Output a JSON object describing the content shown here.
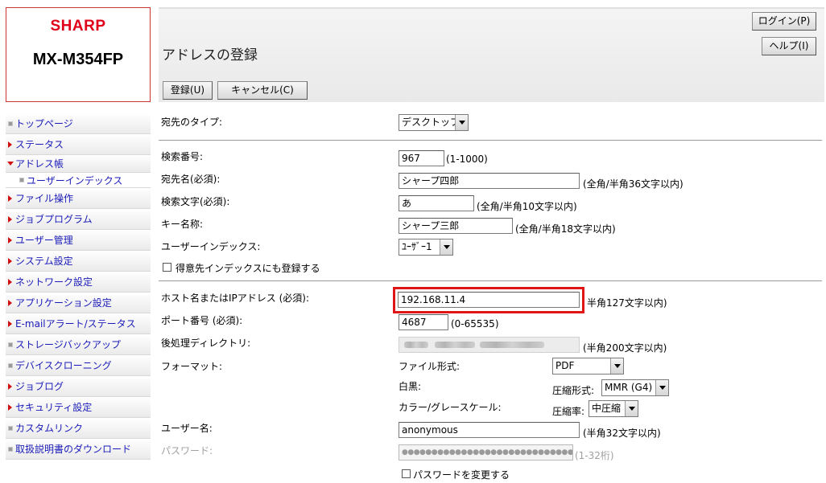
{
  "brand": "SHARP",
  "model": "MX-M354FP",
  "header": {
    "title": "アドレスの登録",
    "login_label": "ログイン(P)",
    "help_label": "ヘルプ(I)",
    "register_label": "登録(U)",
    "cancel_label": "キャンセル(C)"
  },
  "sidebar": {
    "items": [
      {
        "label": "トップページ",
        "marker": "square"
      },
      {
        "label": "ステータス",
        "marker": "arrow-right"
      },
      {
        "label": "アドレス帳",
        "marker": "arrow-down"
      },
      {
        "label": "ユーザーインデックス",
        "marker": "square"
      },
      {
        "label": "ファイル操作",
        "marker": "arrow-right"
      },
      {
        "label": "ジョブプログラム",
        "marker": "arrow-right"
      },
      {
        "label": "ユーザー管理",
        "marker": "arrow-right"
      },
      {
        "label": "システム設定",
        "marker": "arrow-right"
      },
      {
        "label": "ネットワーク設定",
        "marker": "arrow-right"
      },
      {
        "label": "アプリケーション設定",
        "marker": "arrow-right"
      },
      {
        "label": "E-mailアラート/ステータス",
        "marker": "arrow-right"
      },
      {
        "label": "ストレージバックアップ",
        "marker": "square"
      },
      {
        "label": "デバイスクローニング",
        "marker": "square"
      },
      {
        "label": "ジョブログ",
        "marker": "arrow-right"
      },
      {
        "label": "セキュリティ設定",
        "marker": "arrow-right"
      },
      {
        "label": "カスタムリンク",
        "marker": "square"
      },
      {
        "label": "取扱説明書のダウンロード",
        "marker": "square"
      }
    ]
  },
  "form": {
    "dest_type": {
      "label": "宛先のタイプ:",
      "value": "デスクトップ"
    },
    "search_number": {
      "label": "検索番号:",
      "value": "967",
      "hint": "(1-1000)"
    },
    "dest_name": {
      "label": "宛先名(必須):",
      "value": "シャープ四郎",
      "hint": "(全角/半角36文字以内)"
    },
    "search_char": {
      "label": "検索文字(必須):",
      "value": "あ",
      "hint": "(全角/半角10文字以内)"
    },
    "key_name": {
      "label": "キー名称:",
      "value": "シャープ三郎",
      "hint": "(全角/半角18文字以内)"
    },
    "user_index": {
      "label": "ユーザーインデックス:",
      "value": "ﾕｰｻﾞｰ1"
    },
    "favorite_index": {
      "label": "得意先インデックスにも登録する"
    },
    "host": {
      "label": "ホスト名またはIPアドレス (必須):",
      "value": "192.168.11.4",
      "hint": "半角127文字以内)"
    },
    "port": {
      "label": "ポート番号 (必須):",
      "value": "4687",
      "hint": "(0-65535)"
    },
    "post_dir": {
      "label": "後処理ディレクトリ:",
      "hint": "(半角200文字以内)"
    },
    "format": {
      "label": "フォーマット:",
      "file_type_label": "ファイル形式:",
      "file_type_value": "PDF",
      "bw_label": "白黒:",
      "compression_label": "圧縮形式:",
      "compression_value": "MMR (G4)",
      "color_label": "カラー/グレースケール:",
      "rate_label": "圧縮率:",
      "rate_value": "中圧縮"
    },
    "username": {
      "label": "ユーザー名:",
      "value": "anonymous",
      "hint": "(半角32文字以内)"
    },
    "password": {
      "label": "パスワード:",
      "value": "●●●●●●●●●●●●●●●●●●●●●●●●●●●●●●●●",
      "hint": "(1-32桁)"
    },
    "change_password": {
      "label": "パスワードを変更する"
    }
  },
  "colors": {
    "brand": "#e1001a",
    "link": "#1a1ab8",
    "highlight": "#e01515"
  }
}
